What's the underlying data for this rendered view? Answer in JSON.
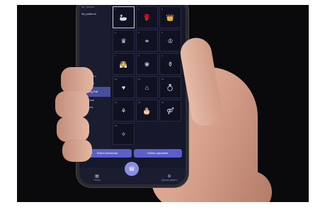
{
  "sidebar": {
    "header_top": "My Stores",
    "items_top": [
      "My patterns"
    ],
    "header_mid": "Color Views",
    "items_mid": [
      "Steamster",
      "Wedding Fall",
      "Christmas",
      "Outdoors"
    ],
    "active_index": 1
  },
  "grid": {
    "cells": [
      {
        "num": "1",
        "icon": "swan-icon",
        "glyph": "🦢",
        "selected": true
      },
      {
        "num": "2",
        "icon": "rose-icon",
        "glyph": "🌹"
      },
      {
        "num": "3",
        "icon": "crown-icon",
        "glyph": "👑"
      },
      {
        "num": "4",
        "icon": "crown-icon",
        "glyph": "♛"
      },
      {
        "num": "5",
        "icon": "couple-icon",
        "glyph": "⚭"
      },
      {
        "num": "6",
        "icon": "tiara-icon",
        "glyph": "♔"
      },
      {
        "num": "7",
        "icon": "bride-icon",
        "glyph": "👰"
      },
      {
        "num": "8",
        "icon": "bouquet-icon",
        "glyph": "❀"
      },
      {
        "num": "9",
        "icon": "bottles-icon",
        "glyph": "⚱"
      },
      {
        "num": "10",
        "icon": "hearts-icon",
        "glyph": "♥"
      },
      {
        "num": "11",
        "icon": "dress-icon",
        "glyph": "⌂"
      },
      {
        "num": "12",
        "icon": "ring-icon",
        "glyph": "💍"
      },
      {
        "num": "13",
        "icon": "shirt-icon",
        "glyph": "⚘"
      },
      {
        "num": "14",
        "icon": "cake-icon",
        "glyph": "🎂"
      },
      {
        "num": "15",
        "icon": "bride-groom-icon",
        "glyph": "⚤"
      },
      {
        "num": "16",
        "icon": "just-married-icon",
        "glyph": "✧"
      }
    ]
  },
  "buttons": {
    "left": "Select download",
    "right": "Delete uploaded"
  },
  "tabbar": {
    "home": "Home",
    "upload": "Upload pattern"
  }
}
